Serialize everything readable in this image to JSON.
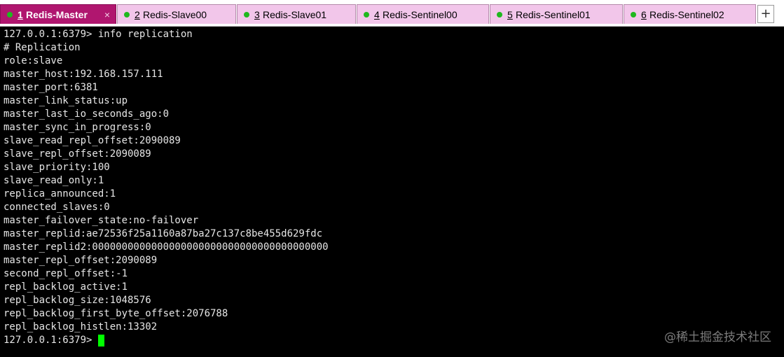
{
  "tabs": [
    {
      "number": "1",
      "label": "Redis-Master",
      "active": true,
      "close": "×"
    },
    {
      "number": "2",
      "label": "Redis-Slave00"
    },
    {
      "number": "3",
      "label": "Redis-Slave01"
    },
    {
      "number": "4",
      "label": "Redis-Sentinel00"
    },
    {
      "number": "5",
      "label": "Redis-Sentinel01"
    },
    {
      "number": "6",
      "label": "Redis-Sentinel02"
    }
  ],
  "new_tab_label": "+",
  "terminal": {
    "lines": [
      "127.0.0.1:6379> info replication",
      "# Replication",
      "role:slave",
      "master_host:192.168.157.111",
      "master_port:6381",
      "master_link_status:up",
      "master_last_io_seconds_ago:0",
      "master_sync_in_progress:0",
      "slave_read_repl_offset:2090089",
      "slave_repl_offset:2090089",
      "slave_priority:100",
      "slave_read_only:1",
      "replica_announced:1",
      "connected_slaves:0",
      "master_failover_state:no-failover",
      "master_replid:ae72536f25a1160a87ba27c137c8be455d629fdc",
      "master_replid2:0000000000000000000000000000000000000000",
      "master_repl_offset:2090089",
      "second_repl_offset:-1",
      "repl_backlog_active:1",
      "repl_backlog_size:1048576",
      "repl_backlog_first_byte_offset:2076788",
      "repl_backlog_histlen:13302"
    ],
    "prompt": "127.0.0.1:6379>"
  },
  "watermark": "@稀土掘金技术社区",
  "colors": {
    "active_tab": "#b0166f",
    "inactive_tab": "#f2c6ea",
    "status_dot": "#1fb81f",
    "terminal_bg": "#000000",
    "terminal_text": "#e6e6e6",
    "cursor": "#00ff00"
  }
}
